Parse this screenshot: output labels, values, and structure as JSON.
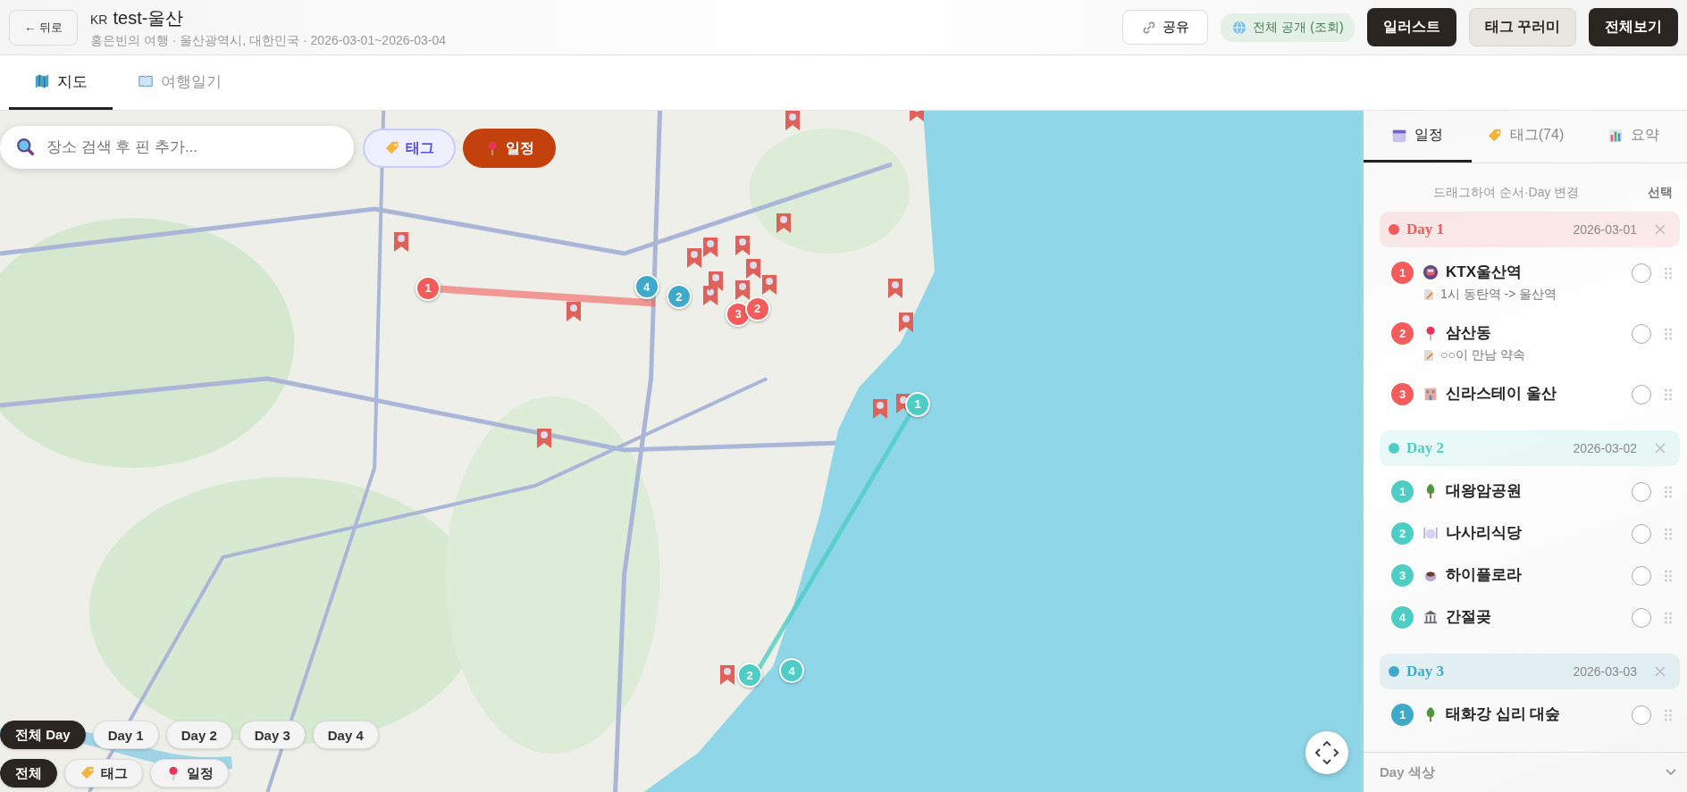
{
  "header": {
    "back_button": "← 뒤로",
    "flag": "KR",
    "title": "test-울산",
    "subtitle": "홍은빈의 여행 · 울산광역시, 대한민국 · 2026-03-01~2026-03-04",
    "share_button": "공유",
    "visibility_badge": "전체 공개 (조회)",
    "actions": [
      {
        "label": "일러스트",
        "kind": "dark"
      },
      {
        "label": "태그 꾸러미",
        "kind": "light"
      },
      {
        "label": "전체보기",
        "kind": "dark"
      }
    ]
  },
  "view_tabs": [
    {
      "label": "지도",
      "kind": "map",
      "selected": true
    },
    {
      "label": "여행일기",
      "kind": "book",
      "selected": false
    }
  ],
  "map": {
    "search": {
      "placeholder": "장소 검색 후 핀 추가..."
    },
    "mode_buttons": [
      {
        "label": "태그",
        "kind": "tag"
      },
      {
        "label": "일정",
        "kind": "schedule"
      }
    ],
    "markers": [
      {
        "label": "1",
        "color": "#f45b5b"
      },
      {
        "label": "4",
        "color": "#3fa9c9"
      },
      {
        "label": "2",
        "color": "#3fa9c9"
      },
      {
        "label": "3",
        "color": "#f45b5b"
      },
      {
        "label": "2",
        "color": "#f45b5b"
      },
      {
        "label": "1",
        "color": "#4ecdc4"
      },
      {
        "label": "2",
        "color": "#4ecdc4"
      },
      {
        "label": "4",
        "color": "#4ecdc4"
      }
    ],
    "day_filters": [
      {
        "label": "전체 Day",
        "selected": true
      },
      {
        "label": "Day 1",
        "selected": false
      },
      {
        "label": "Day 2",
        "selected": false
      },
      {
        "label": "Day 3",
        "selected": false
      },
      {
        "label": "Day 4",
        "selected": false
      }
    ],
    "type_filters": [
      {
        "label": "전체",
        "kind": "all",
        "selected": true
      },
      {
        "label": "태그",
        "kind": "tag",
        "selected": false
      },
      {
        "label": "일정",
        "kind": "schedule",
        "selected": false
      }
    ]
  },
  "sidebar": {
    "tabs": [
      {
        "label": "일정",
        "kind": "calendar",
        "selected": true
      },
      {
        "label": "태그(74)",
        "kind": "tag",
        "selected": false
      },
      {
        "label": "요약",
        "kind": "chart",
        "selected": false
      }
    ],
    "hint": "드래그하여 순서·Day 변경",
    "select_link": "선택",
    "days": [
      {
        "title": "Day 1",
        "date": "2026-03-01",
        "color": "#f45b5b",
        "items": [
          {
            "number": "1",
            "kind": "train",
            "name": "KTX울산역",
            "note": "1시 동탄역 -> 울산역",
            "checked": false
          },
          {
            "number": "2",
            "kind": "pin",
            "name": "삼산동",
            "note": "○○이 만남 약속",
            "checked": false
          },
          {
            "number": "3",
            "kind": "hotel",
            "name": "신라스테이 울산",
            "checked": false
          }
        ]
      },
      {
        "title": "Day 2",
        "date": "2026-03-02",
        "color": "#4ecdc4",
        "items": [
          {
            "number": "1",
            "kind": "tree",
            "name": "대왕암공원",
            "checked": false
          },
          {
            "number": "2",
            "kind": "dining",
            "name": "나사리식당",
            "checked": false
          },
          {
            "number": "3",
            "kind": "coffee",
            "name": "하이플로라",
            "checked": false
          },
          {
            "number": "4",
            "kind": "museum",
            "name": "간절곶",
            "checked": false
          }
        ]
      },
      {
        "title": "Day 3",
        "date": "2026-03-03",
        "color": "#3fa9c9",
        "items": [
          {
            "number": "1",
            "kind": "tree",
            "name": "태화강 십리 대숲",
            "checked": false
          }
        ]
      }
    ],
    "footer": "Day 색상"
  }
}
